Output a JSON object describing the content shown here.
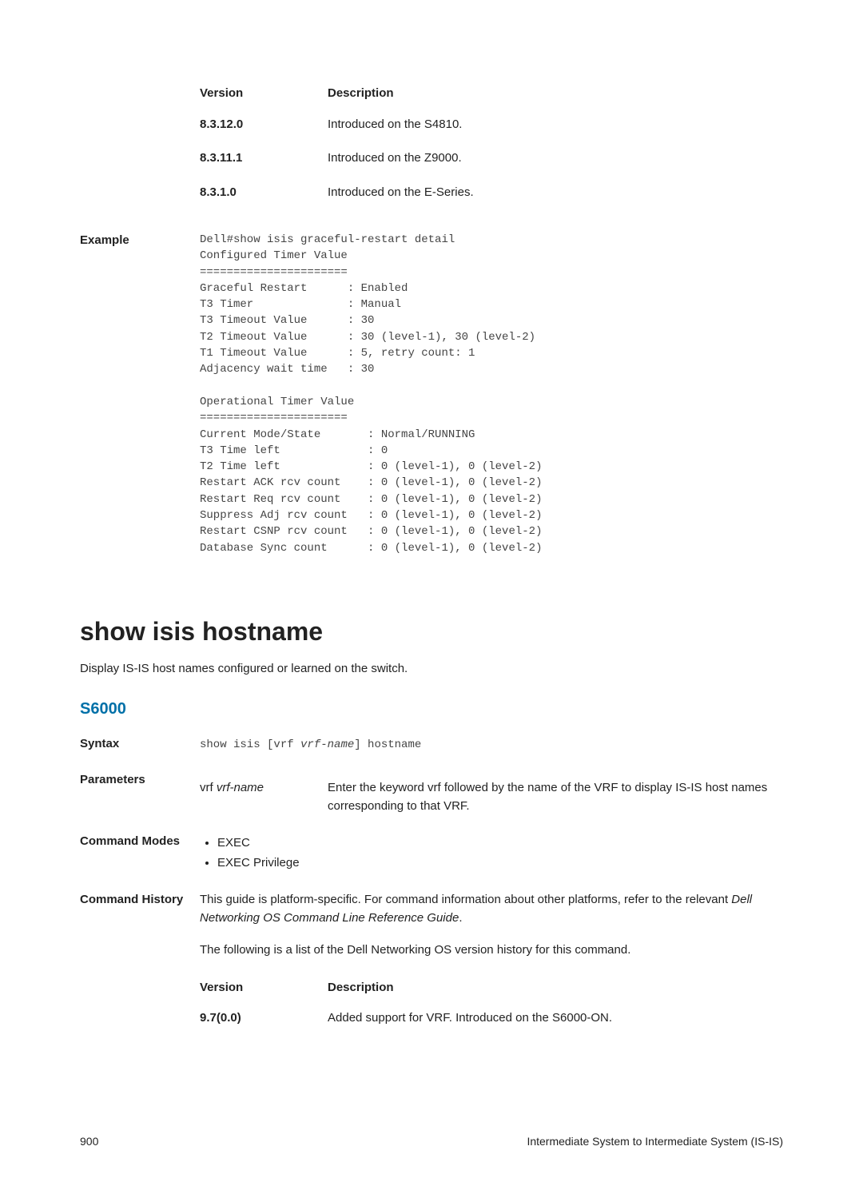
{
  "top_version_table": {
    "header_version": "Version",
    "header_desc": "Description",
    "rows": [
      {
        "ver": "8.3.12.0",
        "desc": "Introduced on the S4810."
      },
      {
        "ver": "8.3.11.1",
        "desc": "Introduced on the Z9000."
      },
      {
        "ver": "8.3.1.0",
        "desc": "Introduced on the E-Series."
      }
    ]
  },
  "example": {
    "label": "Example",
    "code": "Dell#show isis graceful-restart detail\nConfigured Timer Value\n======================\nGraceful Restart      : Enabled\nT3 Timer              : Manual\nT3 Timeout Value      : 30\nT2 Timeout Value      : 30 (level-1), 30 (level-2)\nT1 Timeout Value      : 5, retry count: 1\nAdjacency wait time   : 30\n\nOperational Timer Value\n======================\nCurrent Mode/State       : Normal/RUNNING\nT3 Time left             : 0\nT2 Time left             : 0 (level-1), 0 (level-2)\nRestart ACK rcv count    : 0 (level-1), 0 (level-2)\nRestart Req rcv count    : 0 (level-1), 0 (level-2)\nSuppress Adj rcv count   : 0 (level-1), 0 (level-2)\nRestart CSNP rcv count   : 0 (level-1), 0 (level-2)\nDatabase Sync count      : 0 (level-1), 0 (level-2)"
  },
  "section": {
    "title": "show isis hostname",
    "desc": "Display IS-IS host names configured or learned on the switch.",
    "model": "S6000"
  },
  "syntax": {
    "label": "Syntax",
    "pre": "show isis [vrf ",
    "italic": "vrf-name",
    "post": "] hostname"
  },
  "parameters": {
    "label": "Parameters",
    "key_pre": "vrf ",
    "key_italic": "vrf-name",
    "desc": "Enter the keyword vrf followed by the name of the VRF to display IS-IS host names corresponding to that VRF."
  },
  "command_modes": {
    "label": "Command Modes",
    "items": [
      "EXEC",
      "EXEC Privilege"
    ]
  },
  "command_history": {
    "label": "Command History",
    "para1_pre": "This guide is platform-specific. For command information about other platforms, refer to the relevant ",
    "para1_italic": "Dell Networking OS Command Line Reference Guide",
    "para1_post": ".",
    "para2": "The following is a list of the Dell Networking OS version history for this command.",
    "table": {
      "header_version": "Version",
      "header_desc": "Description",
      "rows": [
        {
          "ver": "9.7(0.0)",
          "desc": "Added support for VRF. Introduced on the S6000-ON."
        }
      ]
    }
  },
  "footer": {
    "page": "900",
    "chapter": "Intermediate System to Intermediate System (IS-IS)"
  }
}
